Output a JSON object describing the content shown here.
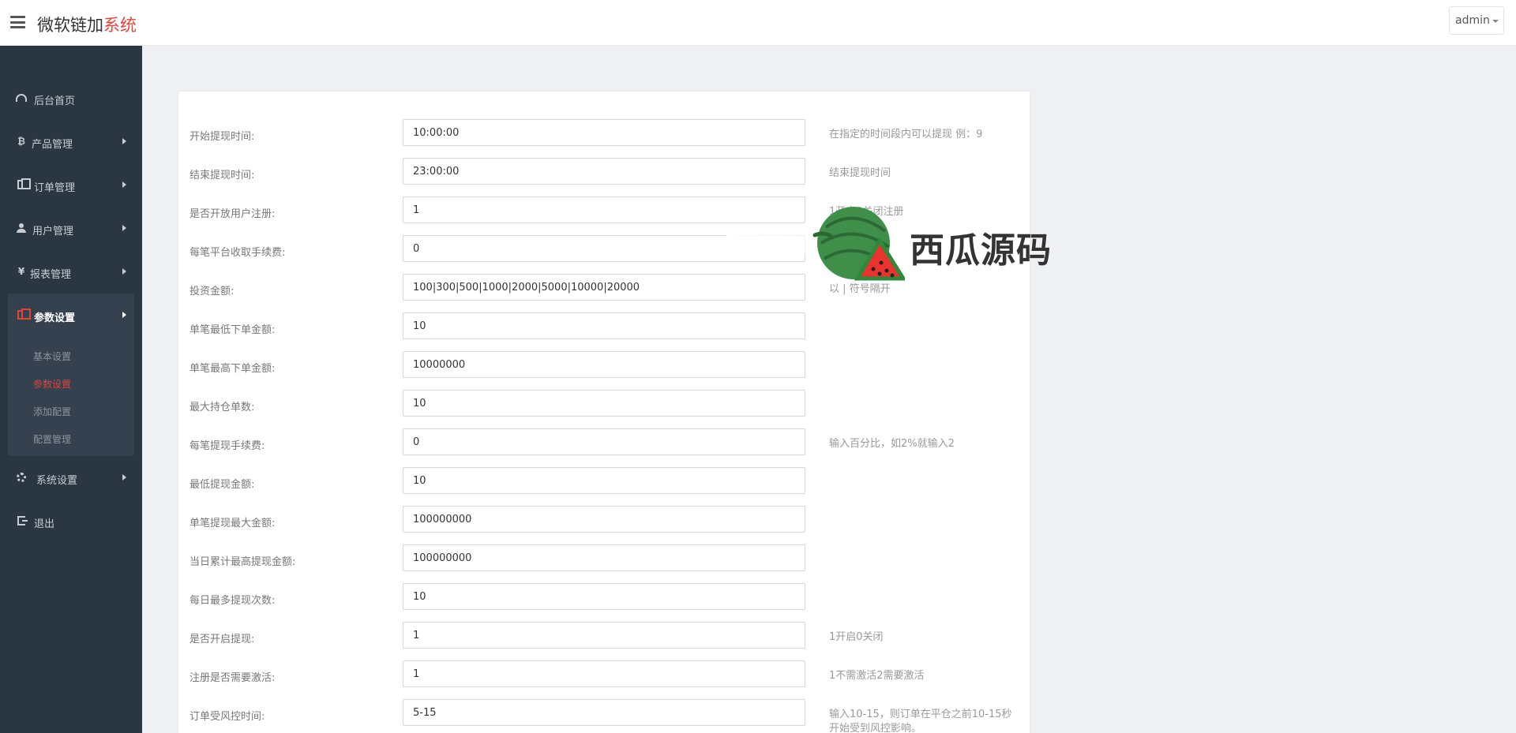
{
  "header": {
    "brand_main": "微软链加",
    "brand_accent": "系统",
    "user_label": "admin"
  },
  "sidebar": {
    "items": [
      {
        "label": "后台首页",
        "icon": "dashboard-icon"
      },
      {
        "label": "产品管理",
        "icon": "bitcoin-icon"
      },
      {
        "label": "订单管理",
        "icon": "files-icon"
      },
      {
        "label": "用户管理",
        "icon": "user-icon"
      },
      {
        "label": "报表管理",
        "icon": "yen-icon"
      },
      {
        "label": "参数设置",
        "icon": "files-icon"
      },
      {
        "label": "系统设置",
        "icon": "gears-icon"
      },
      {
        "label": "退出",
        "icon": "sign-out-icon"
      }
    ],
    "submenu": [
      "基本设置",
      "参数设置",
      "添加配置",
      "配置管理"
    ],
    "submenu_current": "参数设置"
  },
  "form": {
    "rows": [
      {
        "label": "开始提现时间:",
        "value": "10:00:00",
        "help": "在指定的时间段内可以提现 例：9"
      },
      {
        "label": "结束提现时间:",
        "value": "23:00:00",
        "help": "结束提现时间"
      },
      {
        "label": "是否开放用户注册:",
        "value": "1",
        "help": "1开启0关闭注册"
      },
      {
        "label": "每笔平台收取手续费:",
        "value": "0",
        "help": "百分比"
      },
      {
        "label": "投资金额:",
        "value": "100|300|500|1000|2000|5000|10000|20000",
        "help": "以 | 符号隔开"
      },
      {
        "label": "单笔最低下单金额:",
        "value": "10",
        "help": ""
      },
      {
        "label": "单笔最高下单金额:",
        "value": "10000000",
        "help": ""
      },
      {
        "label": "最大持仓单数:",
        "value": "10",
        "help": ""
      },
      {
        "label": "每笔提现手续费:",
        "value": "0",
        "help": "输入百分比，如2%就输入2"
      },
      {
        "label": "最低提现金额:",
        "value": "10",
        "help": ""
      },
      {
        "label": "单笔提现最大金额:",
        "value": "100000000",
        "help": ""
      },
      {
        "label": "当日累计最高提现金额:",
        "value": "100000000",
        "help": ""
      },
      {
        "label": "每日最多提现次数:",
        "value": "10",
        "help": ""
      },
      {
        "label": "是否开启提现:",
        "value": "1",
        "help": "1开启0关闭"
      },
      {
        "label": "注册是否需要激活:",
        "value": "1",
        "help": "1不需激活2需要激活"
      },
      {
        "label": "订单受风控时间:",
        "value": "5-15",
        "help": "输入10-15，则订单在平仓之前10-15秒开始受到风控影响。"
      }
    ]
  },
  "watermark": {
    "text": "西瓜源码"
  },
  "colors": {
    "accent": "#e0443a",
    "sidebar_bg": "#2b3643",
    "sidebar_active_bg": "#364150",
    "page_bg": "#eef0f4"
  }
}
